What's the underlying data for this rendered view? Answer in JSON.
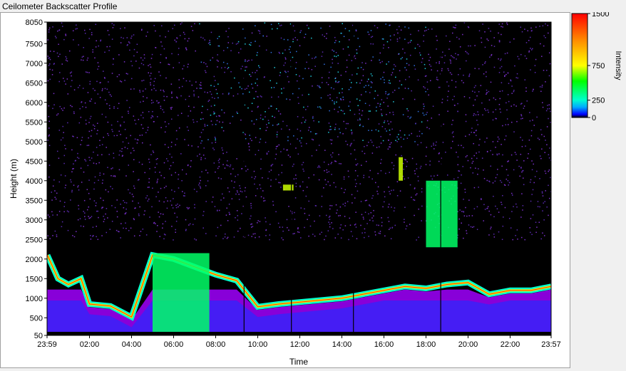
{
  "window": {
    "title": "Ceilometer Backscatter Profile"
  },
  "colors": {
    "background": "#000000",
    "scale_low": "#0000ff",
    "scale_mid": "#00ff00",
    "scale_high": "#ff0000",
    "low_cloud": "#a000ff"
  },
  "chart_data": {
    "type": "heatmap",
    "title": "",
    "xlabel": "Time",
    "ylabel": "Height (m)",
    "ylim": [
      50,
      8050
    ],
    "x_tick_labels": [
      "23:59",
      "02:00",
      "04:00",
      "06:00",
      "08:00",
      "10:00",
      "12:00",
      "14:00",
      "16:00",
      "18:00",
      "20:00",
      "22:00",
      "23:57"
    ],
    "x_tick_hours": [
      -0.0167,
      2,
      4,
      6,
      8,
      10,
      12,
      14,
      16,
      18,
      20,
      22,
      23.95
    ],
    "xlim_hours": [
      -0.0167,
      23.95
    ],
    "y_ticks": [
      50,
      500,
      1000,
      1500,
      2000,
      2500,
      3000,
      3500,
      4000,
      4500,
      5000,
      5500,
      6000,
      6500,
      7000,
      7500,
      8050
    ],
    "y_tick_labels": [
      "50",
      "500",
      "1000",
      "1500",
      "2000",
      "2500",
      "3000",
      "3500",
      "4000",
      "4500",
      "5000",
      "5500",
      "6000",
      "6500",
      "7000",
      "7500",
      "8050"
    ],
    "colorbar": {
      "label": "Intensity",
      "range": [
        0,
        1500
      ],
      "ticks": [
        0,
        250,
        750,
        1500
      ],
      "tick_labels": [
        "0",
        "250",
        "750",
        "1500"
      ]
    },
    "cloud_layer": [
      {
        "time": 0.0,
        "height": 2100
      },
      {
        "time": 0.5,
        "height": 1500
      },
      {
        "time": 1.0,
        "height": 1350
      },
      {
        "time": 1.6,
        "height": 1500
      },
      {
        "time": 2.0,
        "height": 850
      },
      {
        "time": 3.0,
        "height": 800
      },
      {
        "time": 4.0,
        "height": 520
      },
      {
        "time": 5.0,
        "height": 2100
      },
      {
        "time": 6.0,
        "height": 2000
      },
      {
        "time": 7.0,
        "height": 1800
      },
      {
        "time": 8.0,
        "height": 1600
      },
      {
        "time": 9.0,
        "height": 1450
      },
      {
        "time": 10.0,
        "height": 780
      },
      {
        "time": 11.0,
        "height": 850
      },
      {
        "time": 12.0,
        "height": 900
      },
      {
        "time": 13.0,
        "height": 950
      },
      {
        "time": 14.0,
        "height": 1000
      },
      {
        "time": 15.0,
        "height": 1100
      },
      {
        "time": 16.0,
        "height": 1200
      },
      {
        "time": 17.0,
        "height": 1300
      },
      {
        "time": 18.0,
        "height": 1250
      },
      {
        "time": 19.0,
        "height": 1350
      },
      {
        "time": 20.0,
        "height": 1400
      },
      {
        "time": 21.0,
        "height": 1100
      },
      {
        "time": 22.0,
        "height": 1200
      },
      {
        "time": 23.0,
        "height": 1200
      },
      {
        "time": 23.95,
        "height": 1300
      }
    ],
    "features": [
      {
        "name": "fog",
        "t0": 5.0,
        "t1": 7.7,
        "h0": 50,
        "h1": 2150,
        "intensity": 450
      },
      {
        "name": "mid-cloud-a",
        "t0": 11.2,
        "t1": 11.7,
        "h0": 3750,
        "h1": 3900,
        "intensity": 900
      },
      {
        "name": "mid-cloud-b",
        "t0": 16.7,
        "t1": 16.9,
        "h0": 4000,
        "h1": 4600,
        "intensity": 900
      },
      {
        "name": "mid-cloud-c",
        "t0": 18.0,
        "t1": 19.5,
        "h0": 2300,
        "h1": 4000,
        "intensity": 700
      }
    ],
    "vertical_lines_hours": [
      9.35,
      11.6,
      14.55,
      18.7
    ]
  }
}
